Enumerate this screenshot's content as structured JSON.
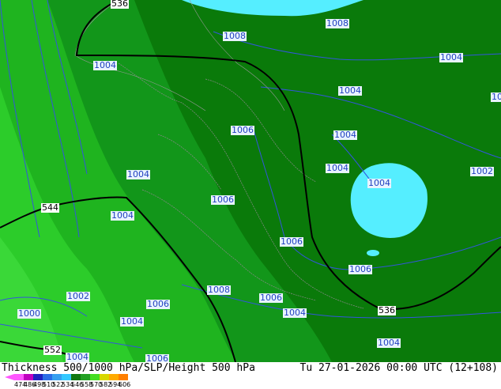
{
  "title": "Thickness 500/1000 hPa/SLP/Height 500 hPa",
  "valid_time": "Tu 27-01-2026 00:00 UTC (12+108)",
  "legend": {
    "ticks": [
      "474",
      "486",
      "498",
      "510",
      "522",
      "534",
      "546",
      "558",
      "570",
      "582",
      "594",
      "606"
    ],
    "colors": [
      "#ff55ff",
      "#c000c0",
      "#2020c0",
      "#2a6de6",
      "#36a0f0",
      "#33c8ff",
      "#117711",
      "#22a022",
      "#44dd22",
      "#d8d800",
      "#ffaa00",
      "#ff7f00"
    ]
  },
  "isobar_labels": [
    "1008",
    "1008",
    "1004",
    "1004",
    "1004",
    "1004",
    "1004",
    "1004",
    "1004",
    "1004",
    "1004",
    "1004",
    "1004",
    "1004",
    "1006",
    "1006",
    "1006",
    "1006",
    "1006",
    "1006",
    "1006",
    "1006",
    "1008",
    "1002",
    "1002",
    "1000",
    "10"
  ],
  "thickness_labels": [
    "536",
    "536",
    "544",
    "552"
  ],
  "colors": {
    "dark_green": "#0a7a0a",
    "mid_green": "#12961a",
    "light_green": "#1fb41f",
    "bright_green": "#2ccc2a",
    "cyan": "#55eeff",
    "isobar": "#3355dd",
    "border": "#8a8a8a"
  }
}
